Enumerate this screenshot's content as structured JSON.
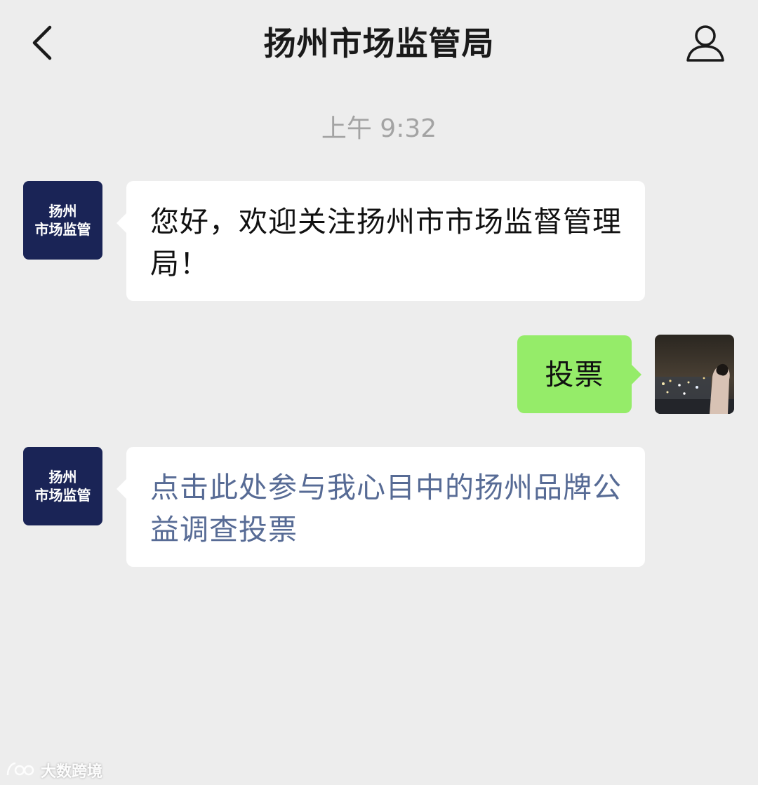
{
  "header": {
    "title": "扬州市场监管局",
    "back_icon": "chevron-left-icon",
    "profile_icon": "person-icon"
  },
  "chat": {
    "timestamp": "上午 9:32",
    "official_avatar": {
      "line1": "扬州",
      "line2": "市场监管"
    },
    "messages": [
      {
        "from": "official",
        "text": "您好，欢迎关注扬州市市场监督管理局！"
      },
      {
        "from": "user",
        "text": "投票"
      },
      {
        "from": "official",
        "type": "link",
        "text": "点击此处参与我心目中的扬州品牌公益调查投票"
      }
    ]
  },
  "watermark": {
    "text": "大数跨境"
  },
  "colors": {
    "background": "#ededed",
    "bubble_incoming": "#ffffff",
    "bubble_outgoing": "#95ec69",
    "link": "#576b95",
    "official_avatar_bg": "#1a2456",
    "timestamp": "#a3a3a3"
  }
}
